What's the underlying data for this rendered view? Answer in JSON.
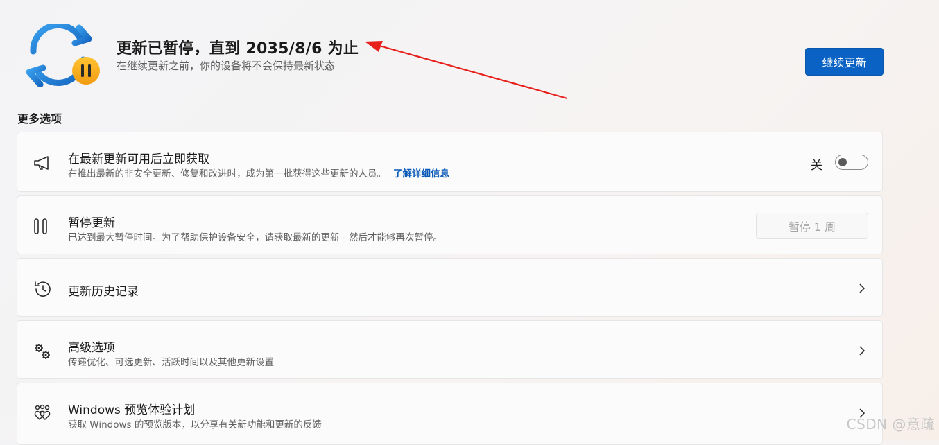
{
  "header": {
    "title": "更新已暂停，直到 2035/8/6 为止",
    "subtitle": "在继续更新之前，你的设备将不会保持最新状态",
    "resume_button": "继续更新",
    "icon": "sync-paused-icon"
  },
  "more_options": {
    "title": "更多选项",
    "items": [
      {
        "label": "在最新更新可用后立即获取",
        "desc": "在推出最新的非安全更新、修复和改进时，成为第一批获得这些更新的人员。",
        "link": "了解详细信息",
        "toggle_label": "关",
        "toggle_on": false,
        "icon": "megaphone-icon"
      },
      {
        "label": "暂停更新",
        "desc": "已达到最大暂停时间。为了帮助保护设备安全，请获取最新的更新 - 然后才能够再次暂停。",
        "button": "暂停 1 周",
        "icon": "pause-icon"
      },
      {
        "label": "更新历史记录",
        "icon": "history-icon"
      },
      {
        "label": "高级选项",
        "desc": "传递优化、可选更新、活跃时间以及其他更新设置",
        "icon": "gears-icon"
      },
      {
        "label": "Windows 预览体验计划",
        "desc": "获取 Windows 的预览版本，以分享有关新功能和更新的反馈",
        "icon": "insider-hearts-icon"
      }
    ]
  },
  "watermark": "CSDN @意疏",
  "colors": {
    "accent": "#0a63c4",
    "annotation_arrow": "#e8201c",
    "pause_badge": "#f7a91f"
  }
}
